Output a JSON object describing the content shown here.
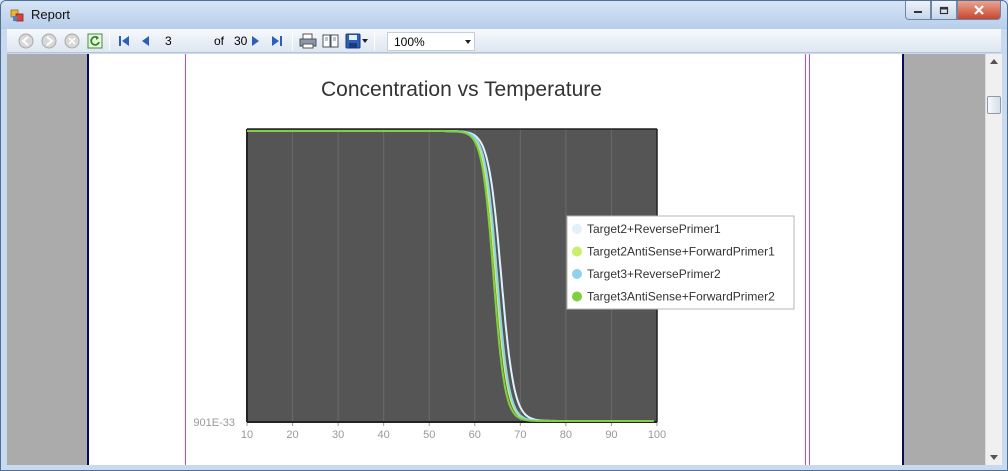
{
  "window": {
    "title": "Report"
  },
  "toolbar": {
    "page_number": "3",
    "of_label": "of",
    "total_pages": "30",
    "zoom": "100%"
  },
  "icons": [
    "back-icon",
    "forward-icon",
    "stop-icon",
    "refresh-icon",
    "first-page-icon",
    "previous-page-icon",
    "next-page-icon",
    "last-page-icon",
    "print-icon",
    "print-layout-icon",
    "save-icon",
    "dropdown-icon"
  ],
  "report": {
    "chart_title": "Concentration vs Temperature"
  },
  "chart_data": {
    "type": "line",
    "title": "Concentration vs Temperature",
    "xlabel": "",
    "ylabel": "",
    "xlim": [
      10,
      100
    ],
    "x_ticks": [
      "10",
      "20",
      "30",
      "40",
      "50",
      "60",
      "70",
      "80",
      "90",
      "100"
    ],
    "y_tick_label": "901E-33",
    "grid": true,
    "legend_position": "right",
    "background": "#555555",
    "series": [
      {
        "name": "Target2+ReversePrimer1",
        "color": "#dff1fb",
        "midpoint": 65.8,
        "width": 1.4
      },
      {
        "name": "Target2AntiSense+ForwardPrimer1",
        "color": "#c9ef6d",
        "midpoint": 64.6,
        "width": 1.3
      },
      {
        "name": "Target3+ReversePrimer2",
        "color": "#8fd2ee",
        "midpoint": 64.9,
        "width": 1.3
      },
      {
        "name": "Target3AntiSense+ForwardPrimer2",
        "color": "#7fcf3f",
        "midpoint": 64.1,
        "width": 1.25
      }
    ]
  }
}
